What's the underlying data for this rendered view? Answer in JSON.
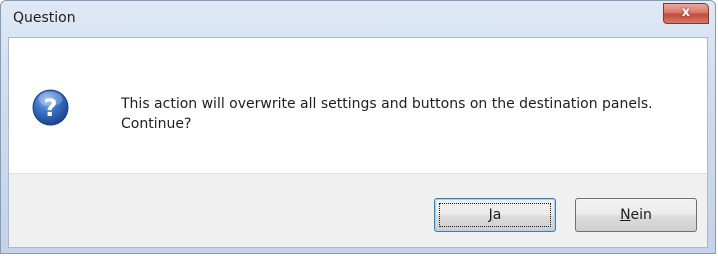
{
  "window": {
    "title": "Question",
    "close_symbol": "x"
  },
  "dialog": {
    "icon": "question-icon",
    "message": "This action will overwrite all settings and buttons on the destination panels. Continue?"
  },
  "buttons": {
    "yes_mnemonic": "J",
    "yes_rest": "a",
    "no_mnemonic": "N",
    "no_rest": "ein"
  },
  "colors": {
    "icon_blue": "#2b5fb3",
    "close_red": "#c24b3c",
    "footer_bg": "#f0f0f0"
  }
}
